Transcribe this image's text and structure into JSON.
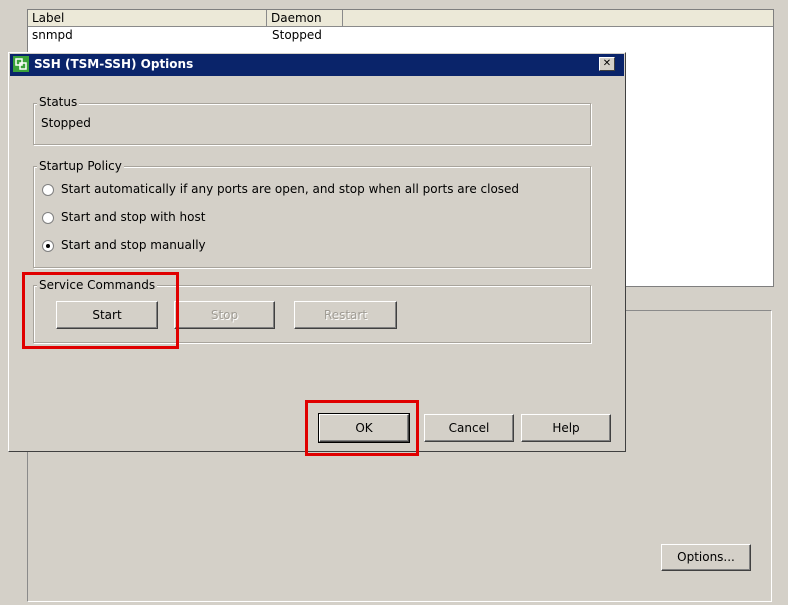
{
  "list": {
    "columns": [
      "Label",
      "Daemon"
    ],
    "rows": [
      {
        "label": "snmpd",
        "daemon": "Stopped"
      }
    ]
  },
  "options_button": "Options...",
  "dialog": {
    "title": "SSH (TSM-SSH) Options",
    "close_glyph": "✕",
    "status": {
      "group_label": "Status",
      "value": "Stopped"
    },
    "startup_policy": {
      "group_label": "Startup Policy",
      "options": [
        {
          "label": "Start automatically if any ports are open, and stop when all ports are closed",
          "selected": false
        },
        {
          "label": "Start and stop with host",
          "selected": false
        },
        {
          "label": "Start and stop manually",
          "selected": true
        }
      ]
    },
    "service_commands": {
      "group_label": "Service Commands",
      "start": "Start",
      "stop": "Stop",
      "restart": "Restart"
    },
    "buttons": {
      "ok": "OK",
      "cancel": "Cancel",
      "help": "Help"
    }
  },
  "colors": {
    "titlebar": "#0a246a",
    "highlight": "#e00000",
    "face": "#d4d0c8"
  }
}
